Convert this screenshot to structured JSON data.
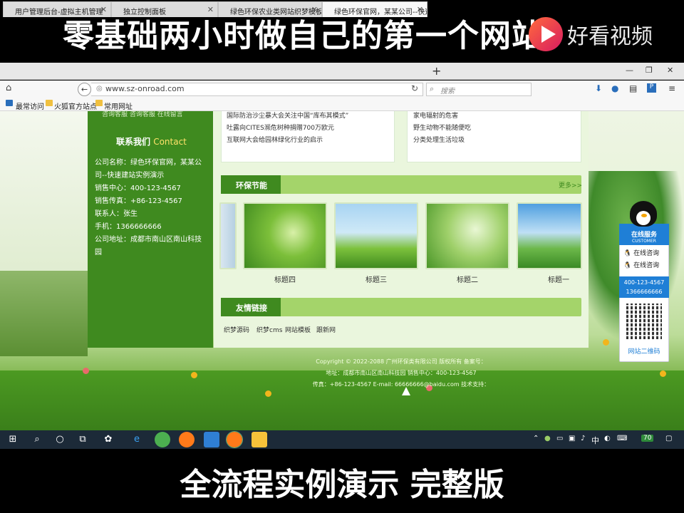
{
  "video": {
    "top_title": "零基础两小时做自己的第一个网站",
    "logo_text": "好看视频",
    "bottom_caption": "全流程实例演示 完整版"
  },
  "browser": {
    "tabs": [
      {
        "label": "用户管理后台-虚拟主机管理",
        "active": false
      },
      {
        "label": "独立控制面板",
        "active": false
      },
      {
        "label": "绿色环保农业类网站织梦模板(带",
        "active": false
      },
      {
        "label": "绿色环保官网，某某公司--快速",
        "active": true
      }
    ],
    "url": "www.sz-onroad.com",
    "search_placeholder": "搜索",
    "bookmarks": [
      "最常访问",
      "火狐官方站点",
      "常用网址"
    ]
  },
  "sidebar": {
    "top_links": "咨询客服    咨询客服    在线留言",
    "contact_title": "联系我们",
    "contact_title_en": "Contact",
    "lines": [
      "公司名称：绿色环保官网，某某公",
      "司--快速建站实例演示",
      "销售中心：400-123-4567",
      "销售传真：+86-123-4567",
      "联系人：张生",
      "手机：1366666666",
      "公司地址：成都市南山区南山科技",
      "园"
    ]
  },
  "news_left": [
    "国际防治沙尘暴大会关注中国“库布其模式”",
    "吐露向CITES濒危树种捐赠700万欧元",
    "互联网大会给园林绿化行业的启示"
  ],
  "news_right": [
    "家电辐射的危害",
    "野生动物不能随便吃",
    "分类处理生活垃圾"
  ],
  "section_energy": {
    "title": "环保节能",
    "more": "更多>>",
    "thumbs": [
      "标题四",
      "标题三",
      "标题二",
      "标题一"
    ]
  },
  "section_links": {
    "title": "友情链接",
    "links": [
      "织梦源码",
      "织梦cms",
      "网站模板",
      "跟新网"
    ]
  },
  "footer": {
    "line1": "Copyright © 2022-2088 广州环保类有限公司 版权所有   备案号：",
    "line2": "地址：成都市南山区南山科技园 销售中心：400-123-4567",
    "line3": "传真：+86-123-4567 E-mail: 66666666@baidu.com 技术支持："
  },
  "float_panel": {
    "title": "在线服务",
    "subtitle": "CUSTOMER",
    "items": [
      "在线咨询",
      "在线咨询"
    ],
    "phone1": "400-123-4567",
    "phone2": "1366666666",
    "qr_label": "网站二维码"
  },
  "taskbar": {
    "ime": "中",
    "badge": "70"
  }
}
